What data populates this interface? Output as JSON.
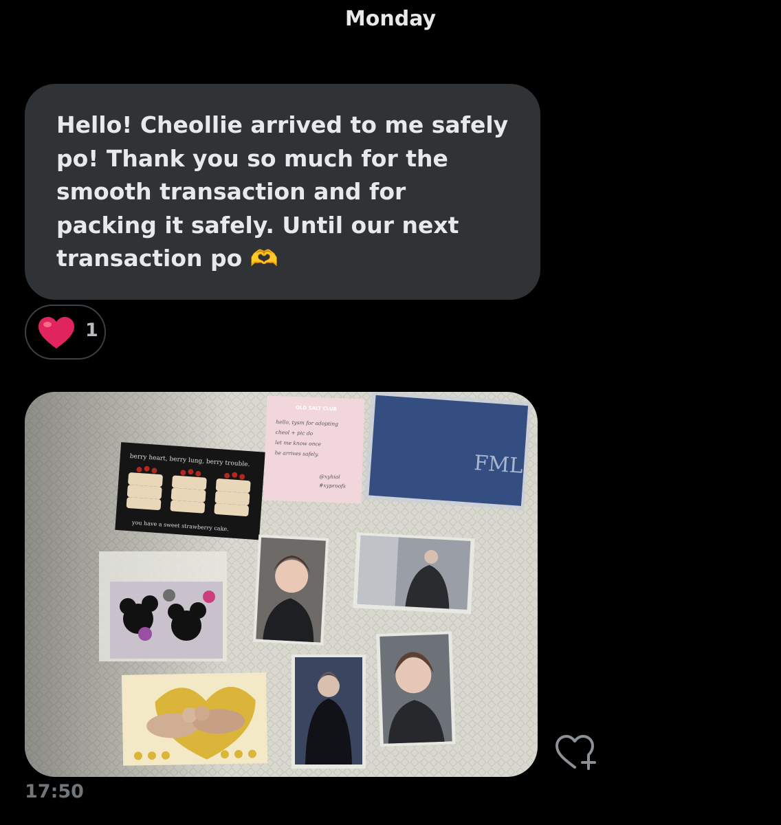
{
  "conversation": {
    "day_label": "Monday",
    "message": {
      "text": "Hello! Cheollie arrived to me safely po! Thank you so much for the smooth transaction and for packing it safely. Until our next transaction po 🫶",
      "lines": [
        "Hello! Cheollie arrived to me safely",
        "po! Thank you so much for the",
        "smooth transaction and for",
        "packing it safely. Until our next",
        "transaction po 🫶"
      ]
    },
    "reaction": {
      "emoji": "❤️",
      "icon": "heart-icon",
      "count": "1",
      "color": "#e0245e"
    },
    "photo": {
      "sticker_top_line": "berry heart, berry lung, berry trouble.",
      "sticker_bottom_line": "you have a sweet strawberry cake.",
      "note_brand": "OLD SALT CLUB",
      "note_lines": [
        "hello, tysm for adopting",
        "cheol + pic do",
        "let me know once",
        "he arrives safely.",
        "@xyhiol",
        "#xyproofs"
      ],
      "album_logo": "FML"
    },
    "like_add_icon": "heart-plus-icon",
    "timestamp": "17:50"
  },
  "colors": {
    "background": "#000000",
    "bubble": "#2f3336",
    "text": "#e7e9ea",
    "muted": "#71767b"
  }
}
